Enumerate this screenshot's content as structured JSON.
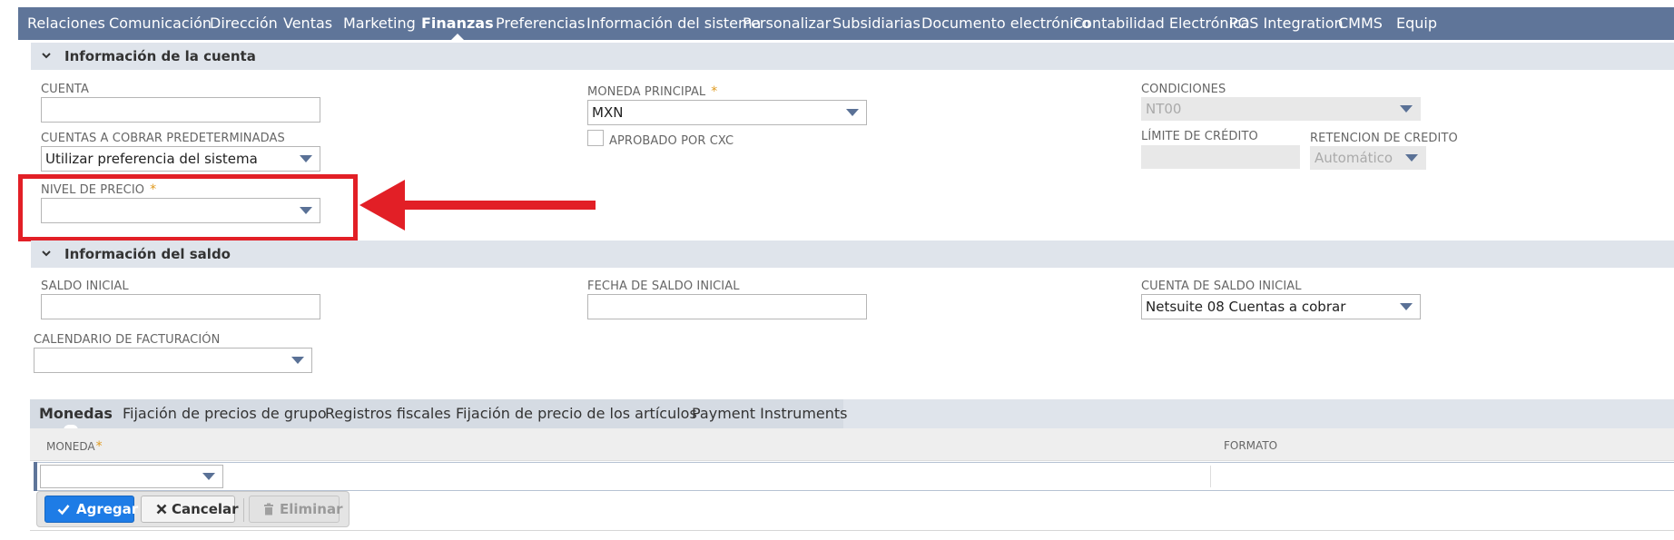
{
  "nav": {
    "items": [
      {
        "label": "Relaciones"
      },
      {
        "label": "Comunicación"
      },
      {
        "label": "Dirección"
      },
      {
        "label": "Ventas"
      },
      {
        "label": "Marketing"
      },
      {
        "label": "Finanzas"
      },
      {
        "label": "Preferencias"
      },
      {
        "label": "Información del sistema"
      },
      {
        "label": "Personalizar"
      },
      {
        "label": "Subsidiarias"
      },
      {
        "label": "Documento electrónico"
      },
      {
        "label": "Contabilidad Electrónica"
      },
      {
        "label": "POS Integration"
      },
      {
        "label": "CMMS"
      },
      {
        "label": "Equip"
      }
    ],
    "active": "Finanzas",
    "background": "#5f7599"
  },
  "account_section": {
    "title": "Información de la cuenta",
    "cuenta": {
      "label": "Cuenta",
      "value": ""
    },
    "cuentas_cobrar": {
      "label": "Cuentas a cobrar predeterminadas",
      "value": "Utilizar preferencia del sistema"
    },
    "nivel_precio": {
      "label": "Nivel de precio",
      "required": "*",
      "value": ""
    },
    "moneda_principal": {
      "label": "Moneda principal",
      "required": "*",
      "value": "MXN"
    },
    "aprobado_cxc": {
      "label": "Aprobado por CXC",
      "checked": false
    },
    "condiciones": {
      "label": "Condiciones",
      "value": "NT00"
    },
    "limite_credito": {
      "label": "Límite de crédito",
      "value": ""
    },
    "retencion_credito": {
      "label": "Retencion de credito",
      "value": "Automático"
    }
  },
  "balance_section": {
    "title": "Información del saldo",
    "saldo_inicial": {
      "label": "Saldo inicial",
      "value": ""
    },
    "fecha_saldo_inicial": {
      "label": "Fecha de saldo inicial",
      "value": ""
    },
    "cuenta_saldo_inicial": {
      "label": "Cuenta de saldo inicial",
      "value": "Netsuite 08 Cuentas a cobrar"
    },
    "calendario_facturacion": {
      "label": "Calendario de facturación",
      "value": ""
    }
  },
  "tabs": {
    "items": [
      {
        "label": "Monedas"
      },
      {
        "label": "Fijación de precios de grupo"
      },
      {
        "label": "Registros fiscales"
      },
      {
        "label": "Fijación de precio de los artículos"
      },
      {
        "label": "Payment Instruments"
      }
    ],
    "active": "Monedas"
  },
  "sublist": {
    "columns": [
      {
        "label": "Moneda",
        "required": "*"
      },
      {
        "label": "Formato"
      }
    ],
    "row": {
      "moneda": "",
      "formato": ""
    },
    "buttons": {
      "add": "Agregar",
      "cancel": "Cancelar",
      "delete": "Eliminar"
    }
  },
  "colors": {
    "highlight": "#e21f26",
    "primary_button": "#1e7ce6",
    "required_star": "#e09a1e",
    "section_bg": "#dfe4eb"
  }
}
